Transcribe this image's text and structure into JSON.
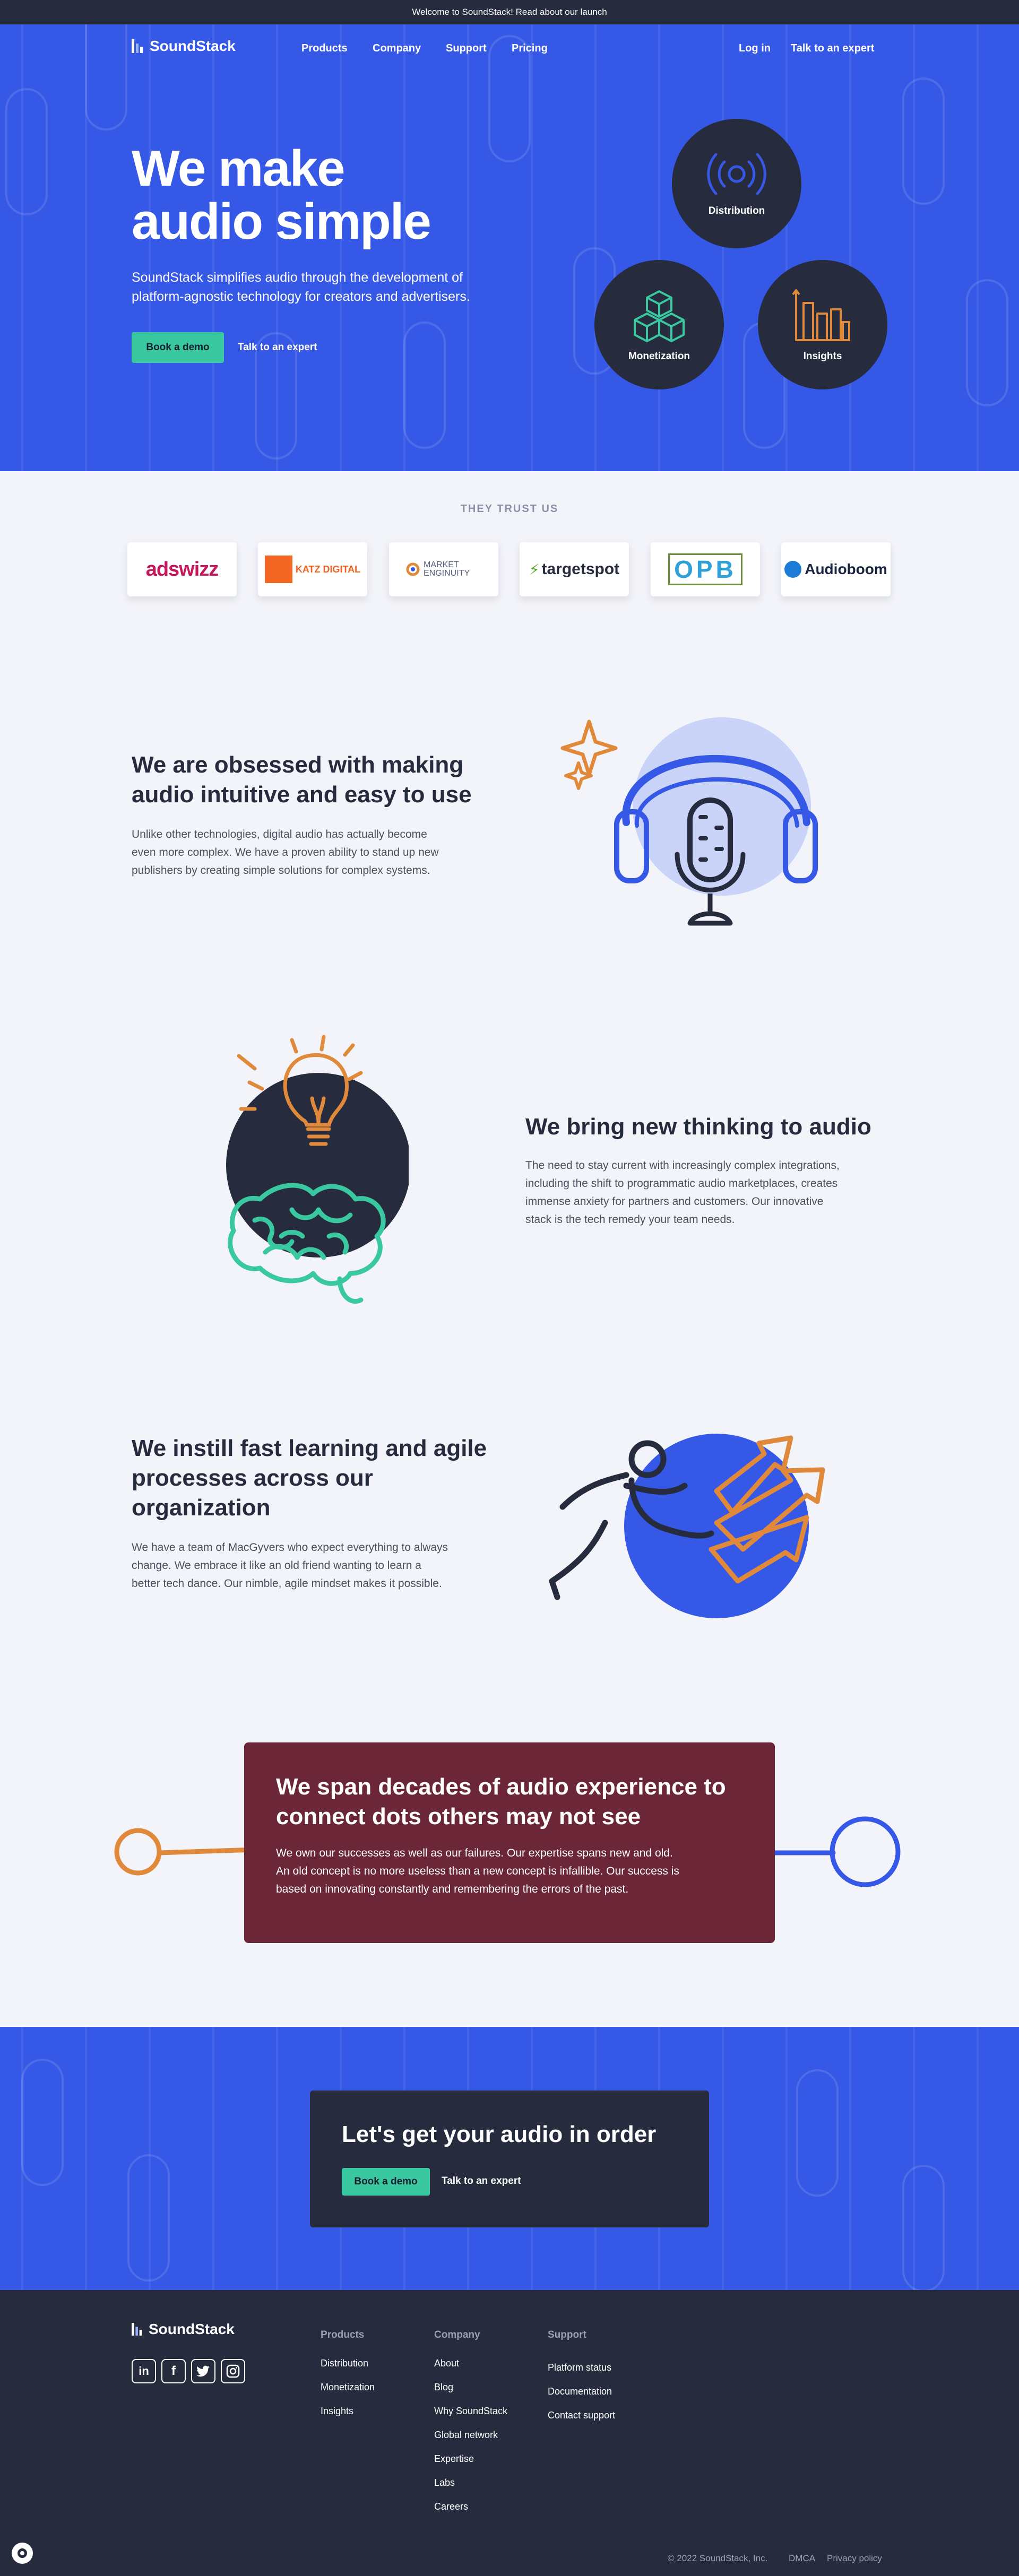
{
  "announcement": "Welcome to SoundStack! Read about our launch",
  "brand": {
    "name": "SoundStack"
  },
  "nav": {
    "items": [
      "Products",
      "Company",
      "Support",
      "Pricing"
    ],
    "login": "Log in",
    "expert": "Talk to an expert"
  },
  "hero": {
    "title_line1": "We make",
    "title_line2": "audio simple",
    "subtitle_line1": "SoundStack simplifies audio through the development of",
    "subtitle_line2": "platform-agnostic technology for creators and advertisers.",
    "cta_primary": "Book a demo",
    "cta_secondary": "Talk to an expert",
    "circles": [
      "Distribution",
      "Monetization",
      "Insights"
    ]
  },
  "trust": {
    "heading": "THEY TRUST US",
    "logos": [
      "adswizz",
      "KATZ DIGITAL",
      "MARKET ENGINUITY",
      "targetspot",
      "OPB",
      "Audioboom"
    ]
  },
  "sections": [
    {
      "title_lines": [
        "We are obsessed with making",
        "audio intuitive and easy to use"
      ],
      "body_lines": [
        "Unlike other technologies, digital audio has actually become",
        "even more complex. We have a proven ability to stand up new",
        "publishers by creating simple solutions for complex systems."
      ]
    },
    {
      "title_lines": [
        "We bring new thinking to audio"
      ],
      "body_lines": [
        "The need to stay current with increasingly complex integrations,",
        "including the shift to programmatic audio marketplaces, creates",
        "immense anxiety for partners and customers. Our innovative",
        "stack is the tech remedy your team needs."
      ]
    },
    {
      "title_lines": [
        "We instill fast learning and agile",
        "processes across our",
        "organization"
      ],
      "body_lines": [
        "We have a team of MacGyvers who expect everything to always",
        "change. We embrace it like an old friend wanting to learn a",
        "better tech dance. Our nimble, agile mindset makes it possible."
      ]
    }
  ],
  "experience": {
    "title_lines": [
      "We span decades of audio experience to",
      "connect dots others may not see"
    ],
    "body_lines": [
      "We own our successes as well as our failures. Our expertise spans new and old.",
      "An old concept is no more useless than a new concept is infallible. Our success is",
      "based on innovating constantly and remembering the errors of the past."
    ]
  },
  "cta": {
    "title": "Let's get your audio in order",
    "primary": "Book a demo",
    "secondary": "Talk to an expert"
  },
  "footer": {
    "products_heading": "Products",
    "products": [
      "Distribution",
      "Monetization",
      "Insights"
    ],
    "company_heading": "Company",
    "company": [
      "About",
      "Blog",
      "Why SoundStack",
      "Global network",
      "Expertise",
      "Labs",
      "Careers"
    ],
    "support_heading": "Support",
    "support": [
      "Platform status",
      "Documentation",
      "Contact support"
    ],
    "social": [
      "linkedin-icon",
      "facebook-icon",
      "twitter-icon",
      "instagram-icon"
    ],
    "copyright": "© 2022 SoundStack, Inc.",
    "dmca": "DMCA",
    "privacy": "Privacy policy"
  },
  "colors": {
    "brand_blue": "#3658e6",
    "navy": "#262c3d",
    "green": "#39c8a0",
    "maroon": "#6b2737",
    "orange": "#e0893a"
  }
}
